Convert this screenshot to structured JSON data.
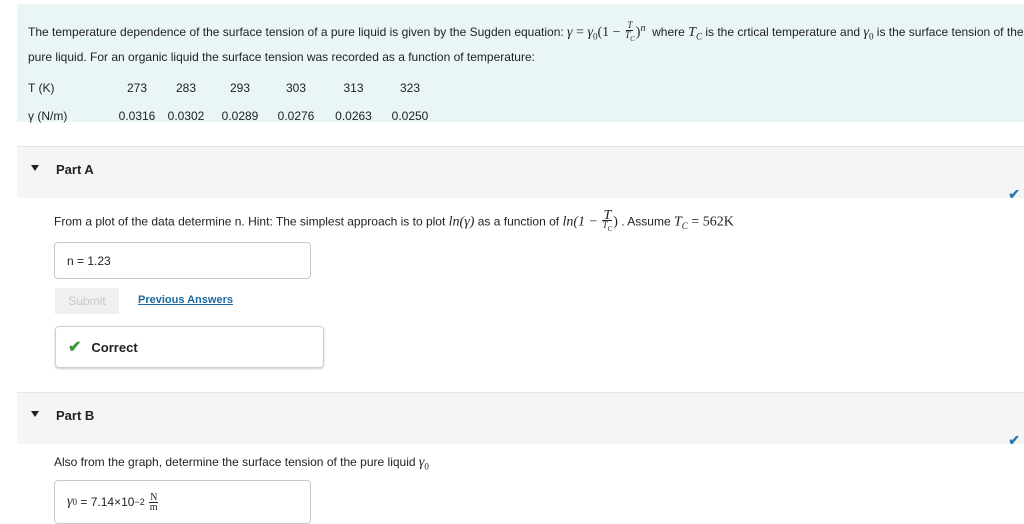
{
  "intro": {
    "text1": "The temperature dependence of the surface tension of a pure liquid is given by the Sugden equation:",
    "eq_gamma": "γ",
    "eq_eq": " = ",
    "eq_gamma0": "γ",
    "eq_sub0": "0",
    "eq_open": "(1 − ",
    "eq_T": "T",
    "eq_Tc": "T",
    "eq_Tc_sub": "C",
    "eq_close": ")",
    "eq_exp": "n",
    "text2": "where",
    "tc": "T",
    "tc_sub": "C",
    "text3": "is the crtical temperature and",
    "g0": "γ",
    "g0_sub": "0",
    "text4": "is the surface tension of the pure liquid. For an organic liquid the surface tension was recorded as a function of temperature:"
  },
  "table": {
    "row_labels": [
      "T (K)",
      "γ (N/m)"
    ],
    "T": [
      "273",
      "283",
      "293",
      "303",
      "313",
      "323"
    ],
    "gamma": [
      "0.0316",
      "0.0302",
      "0.0289",
      "0.0276",
      "0.0263",
      "0.0250"
    ]
  },
  "partA": {
    "label": "Part A",
    "q1": "From a plot of the data determine n. Hint: The simplest approach is to plot",
    "ln_gamma": "ln(γ)",
    "q2": "as a function of",
    "ln2_open": "ln(1 − ",
    "ln2_T": "T",
    "ln2_Tc": "T",
    "ln2_sub": "C",
    "ln2_close": ")",
    "q3": ". Assume",
    "assume_T": "T",
    "assume_sub": "C",
    "assume_val": " = 562K",
    "answer_label": "n =",
    "answer_value": "1.23",
    "submit": "Submit",
    "previous": "Previous Answers",
    "feedback": "Correct"
  },
  "partB": {
    "label": "Part B",
    "q": "Also from the graph, determine the surface tension of the pure liquid",
    "g0": "γ",
    "g0_sub": "0",
    "answer_label_sym": "γ",
    "answer_label_sub": "0",
    "answer_eq": "=",
    "answer_value": "7.14×10",
    "answer_exp": "−2",
    "unit_num": "N",
    "unit_den": "m"
  },
  "colors": {
    "intro_bg": "#eaf5f6",
    "link": "#1a6aa0",
    "correct": "#3a9a3a",
    "check": "#2a7ab0"
  },
  "icons": {
    "collapse": "triangle-down-icon",
    "status": "checkmark-icon"
  }
}
